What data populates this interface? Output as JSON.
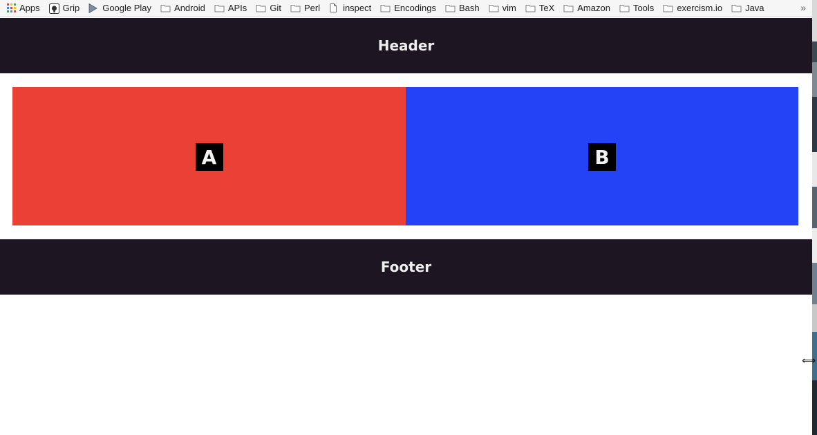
{
  "bookmarks": [
    {
      "label": "Apps",
      "icon": "apps-grid-icon"
    },
    {
      "label": "Grip",
      "icon": "github-icon"
    },
    {
      "label": "Google Play",
      "icon": "google-play-icon"
    },
    {
      "label": "Android",
      "icon": "folder-icon"
    },
    {
      "label": "APIs",
      "icon": "folder-icon"
    },
    {
      "label": "Git",
      "icon": "folder-icon"
    },
    {
      "label": "Perl",
      "icon": "folder-icon"
    },
    {
      "label": "inspect",
      "icon": "file-icon"
    },
    {
      "label": "Encodings",
      "icon": "folder-icon"
    },
    {
      "label": "Bash",
      "icon": "folder-icon"
    },
    {
      "label": "vim",
      "icon": "folder-icon"
    },
    {
      "label": "TeX",
      "icon": "folder-icon"
    },
    {
      "label": "Amazon",
      "icon": "folder-icon"
    },
    {
      "label": "Tools",
      "icon": "folder-icon"
    },
    {
      "label": "exercism.io",
      "icon": "folder-icon"
    },
    {
      "label": "Java",
      "icon": "folder-icon"
    }
  ],
  "overflow": "»",
  "page": {
    "header": "Header",
    "panel_a": "A",
    "panel_b": "B",
    "footer": "Footer"
  },
  "colors": {
    "header_bg": "#1d1622",
    "panel_a": "#ea4036",
    "panel_b": "#2443f6",
    "label_bg": "#000000"
  },
  "cursor": "⟺"
}
